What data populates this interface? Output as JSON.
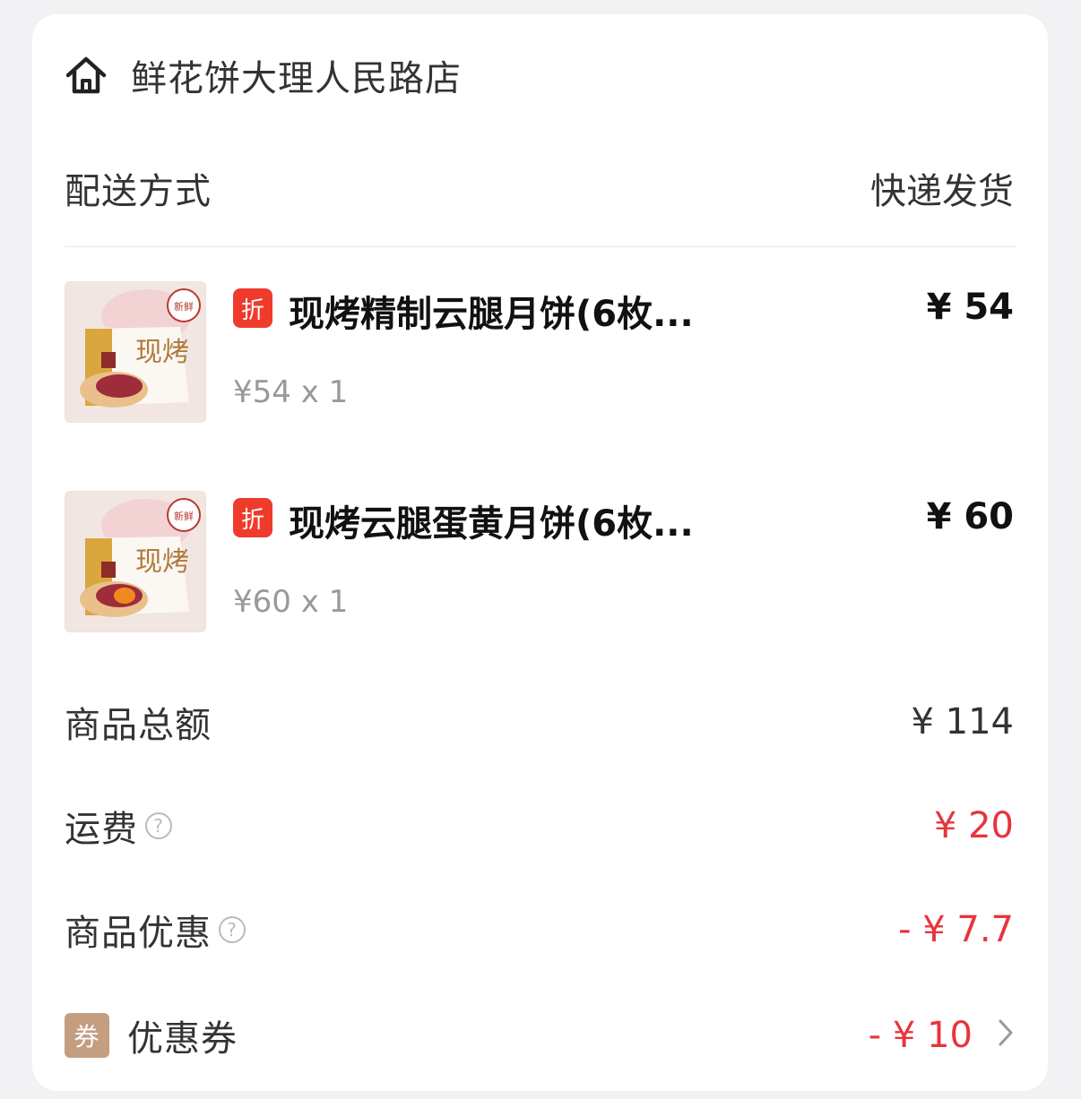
{
  "store": {
    "name": "鲜花饼大理人民路店",
    "icon": "home-icon"
  },
  "delivery": {
    "label": "配送方式",
    "value": "快递发货"
  },
  "products": [
    {
      "tag": "折",
      "name": "现烤精制云腿月饼(6枚...",
      "price": "¥ 54",
      "qty": "¥54 x 1",
      "variant": "plain"
    },
    {
      "tag": "折",
      "name": "现烤云腿蛋黄月饼(6枚...",
      "price": "¥ 60",
      "qty": "¥60 x 1",
      "variant": "yolk"
    }
  ],
  "summary": {
    "subtotal": {
      "label": "商品总额",
      "value": "¥ 114"
    },
    "shipping": {
      "label": "运费",
      "value": "¥ 20"
    },
    "discount": {
      "label": "商品优惠",
      "value": "- ¥ 7.7"
    },
    "coupon": {
      "badge": "券",
      "label": "优惠券",
      "value": "- ¥ 10"
    }
  },
  "box_text": "现烤",
  "colors": {
    "accent_red": "#e7343e",
    "tag_red": "#ef3b2c",
    "coupon_badge": "#c49e80"
  }
}
